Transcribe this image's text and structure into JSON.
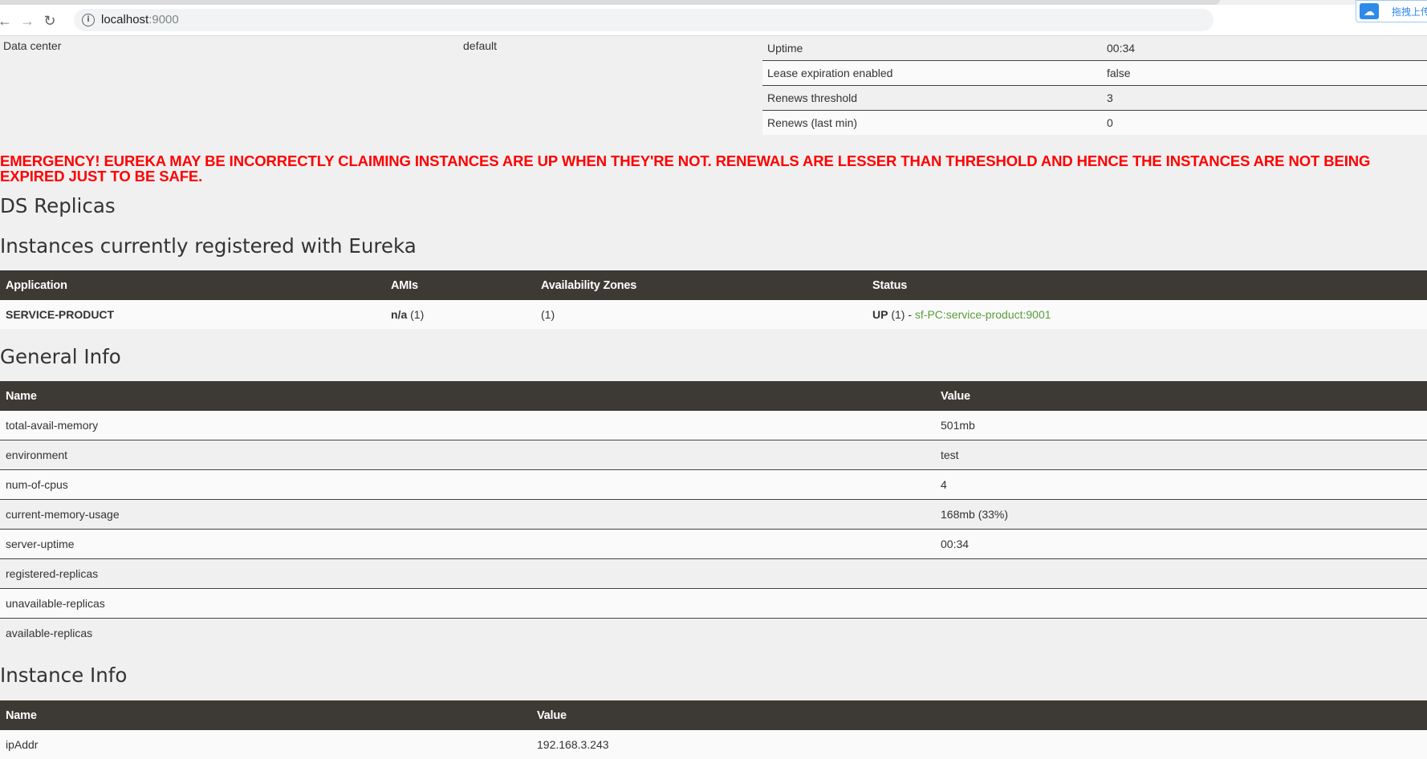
{
  "browser": {
    "url_host": "localhost",
    "url_port": ":9000",
    "extension_label": "拖拽上传"
  },
  "environment": {
    "left": {
      "label": "Data center",
      "value": "default"
    },
    "right": [
      {
        "label": "Uptime",
        "value": "00:34"
      },
      {
        "label": "Lease expiration enabled",
        "value": "false"
      },
      {
        "label": "Renews threshold",
        "value": "3"
      },
      {
        "label": "Renews (last min)",
        "value": "0"
      }
    ]
  },
  "emergency_message": "EMERGENCY! EUREKA MAY BE INCORRECTLY CLAIMING INSTANCES ARE UP WHEN THEY'RE NOT. RENEWALS ARE LESSER THAN THRESHOLD AND HENCE THE INSTANCES ARE NOT BEING EXPIRED JUST TO BE SAFE.",
  "ds_replicas_title": "DS Replicas",
  "instances": {
    "title": "Instances currently registered with Eureka",
    "headers": [
      "Application",
      "AMIs",
      "Availability Zones",
      "Status"
    ],
    "row": {
      "application": "SERVICE-PRODUCT",
      "amis_bold": "n/a",
      "amis_count": " (1)",
      "zones": "(1)",
      "status_bold": "UP",
      "status_count": " (1) - ",
      "status_link": "sf-PC:service-product:9001"
    }
  },
  "general_info": {
    "title": "General Info",
    "headers": [
      "Name",
      "Value"
    ],
    "rows": [
      {
        "name": "total-avail-memory",
        "value": "501mb"
      },
      {
        "name": "environment",
        "value": "test"
      },
      {
        "name": "num-of-cpus",
        "value": "4"
      },
      {
        "name": "current-memory-usage",
        "value": "168mb (33%)"
      },
      {
        "name": "server-uptime",
        "value": "00:34"
      },
      {
        "name": "registered-replicas",
        "value": ""
      },
      {
        "name": "unavailable-replicas",
        "value": ""
      },
      {
        "name": "available-replicas",
        "value": ""
      }
    ]
  },
  "instance_info": {
    "title": "Instance Info",
    "headers": [
      "Name",
      "Value"
    ],
    "rows": [
      {
        "name": "ipAddr",
        "value": "192.168.3.243"
      }
    ]
  },
  "icons": {
    "back": "arrow-left-icon",
    "forward": "arrow-right-icon",
    "reload": "reload-icon",
    "info": "info-icon",
    "extension": "cloud-icon"
  }
}
